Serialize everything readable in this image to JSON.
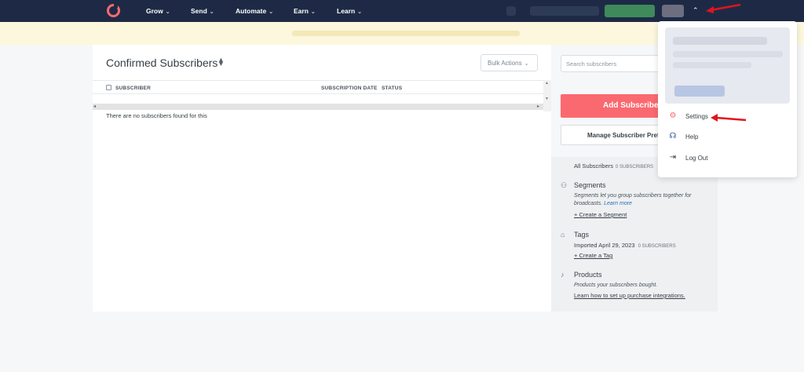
{
  "nav": {
    "items": [
      {
        "label": "Grow"
      },
      {
        "label": "Send"
      },
      {
        "label": "Automate"
      },
      {
        "label": "Earn"
      },
      {
        "label": "Learn"
      }
    ],
    "caret": "⌄",
    "account_caret": "⌃"
  },
  "main": {
    "title": "Confirmed Subscribers",
    "sort_glyph": "▲▼",
    "bulk_actions": "Bulk Actions",
    "columns": {
      "subscriber": "SUBSCRIBER",
      "subscription_date": "SUBSCRIPTION DATE",
      "status": "STATUS"
    },
    "empty_message": "There are no subscribers found for this"
  },
  "sidebar": {
    "search_placeholder": "Search subscribers",
    "add_button": "Add Subscribers",
    "manage_button": "Manage Subscriber Preferences",
    "all_subscribers": "All Subscribers",
    "all_subscribers_count": "0 SUBSCRIBERS",
    "segments": {
      "title": "Segments",
      "desc": "Segments let you group subscribers together for broadcasts.",
      "learn_more": "Learn more",
      "create_link": "+ Create a Segment"
    },
    "tags": {
      "title": "Tags",
      "tag_name": "Imported April 29, 2023",
      "tag_count": "0 SUBSCRIBERS",
      "create_link": "+ Create a Tag"
    },
    "products": {
      "title": "Products",
      "desc": "Products your subscribers bought.",
      "link": "Learn how to set up purchase integrations."
    }
  },
  "account_menu": {
    "items": [
      {
        "label": "Settings",
        "icon": "gear-icon"
      },
      {
        "label": "Help",
        "icon": "headset-icon"
      },
      {
        "label": "Log Out",
        "icon": "logout-icon"
      }
    ]
  },
  "colors": {
    "nav_bg": "#1e2a45",
    "brand": "#fb6970",
    "banner_bg": "#fdf7de",
    "annotation": "#e0141e"
  }
}
